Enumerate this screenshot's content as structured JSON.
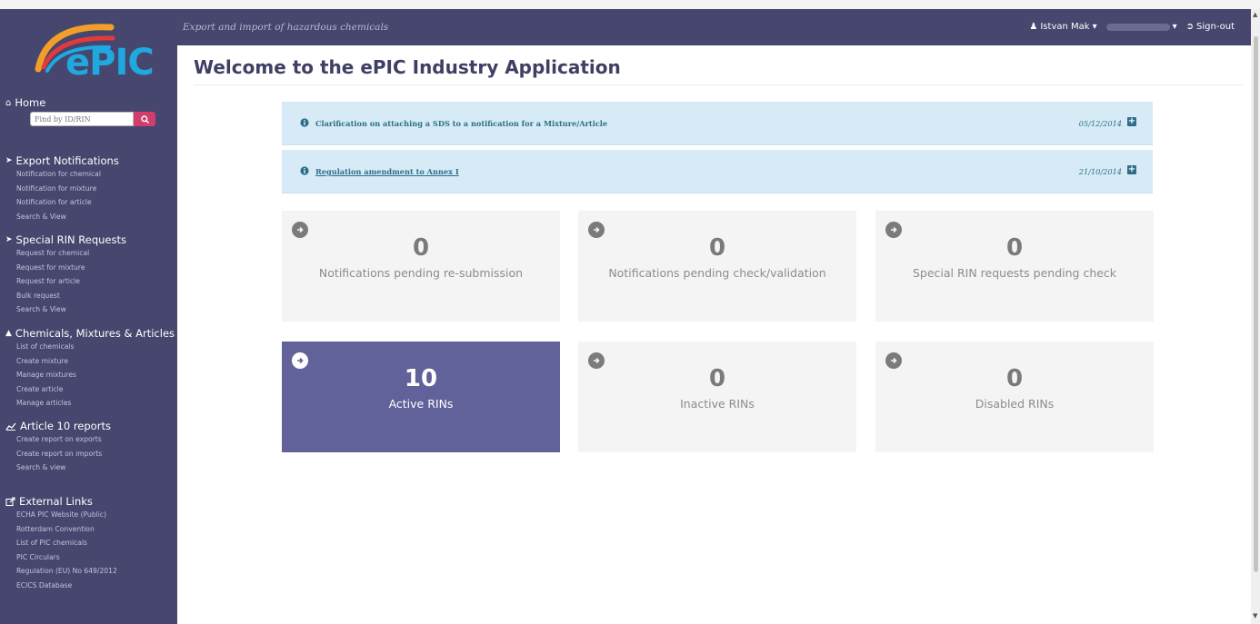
{
  "app": {
    "logo_text": "ePIC",
    "tagline": "Export and import of hazardous chemicals",
    "user_name": "Istvan Mak",
    "sign_out": "Sign-out"
  },
  "page": {
    "title": "Welcome to the ePIC Industry Application"
  },
  "sidebar": {
    "home_label": "Home",
    "search_placeholder": "Find by ID/RIN",
    "sections": [
      {
        "title": "Export Notifications",
        "icon": "circle-arrow-right-icon",
        "items": [
          "Notification for chemical",
          "Notification for mixture",
          "Notification for article",
          "Search & View"
        ]
      },
      {
        "title": "Special RIN Requests",
        "icon": "circle-arrow-right-icon",
        "items": [
          "Request for chemical",
          "Request for mixture",
          "Request for article",
          "Bulk request",
          "Search & View"
        ]
      },
      {
        "title": "Chemicals, Mixtures & Articles",
        "icon": "flask-icon",
        "items": [
          "List of chemicals",
          "Create mixture",
          "Manage mixtures",
          "Create article",
          "Manage articles"
        ]
      },
      {
        "title": "Article 10 reports",
        "icon": "line-chart-icon",
        "items": [
          "Create report on exports",
          "Create report on imports",
          "Search & view"
        ]
      },
      {
        "title": "External Links",
        "icon": "external-link-icon",
        "items": [
          "ECHA PIC Website (Public)",
          "Rotterdam Convention",
          "List of PIC chemicals",
          "PIC Circulars",
          "Regulation (EU) No 649/2012",
          "ECICS Database"
        ]
      }
    ]
  },
  "notices": [
    {
      "text": "Clarification on attaching a SDS to a notification for a Mixture/Article",
      "date": "05/12/2014"
    },
    {
      "text": "Regulation amendment to Annex I",
      "date": "21/10/2014"
    }
  ],
  "tiles": [
    {
      "value": "0",
      "label": "Notifications pending re-submission"
    },
    {
      "value": "0",
      "label": "Notifications pending check/validation"
    },
    {
      "value": "0",
      "label": "Special RIN requests pending check"
    },
    {
      "value": "10",
      "label": "Active RINs"
    },
    {
      "value": "0",
      "label": "Inactive RINs"
    },
    {
      "value": "0",
      "label": "Disabled RINs"
    }
  ],
  "colors": {
    "sidebar_bg": "#46466e",
    "accent_active_tile": "#62629a",
    "notice_bg": "#d6ebf6",
    "search_button": "#d23e6b",
    "logo_blue": "#1fa9df"
  }
}
